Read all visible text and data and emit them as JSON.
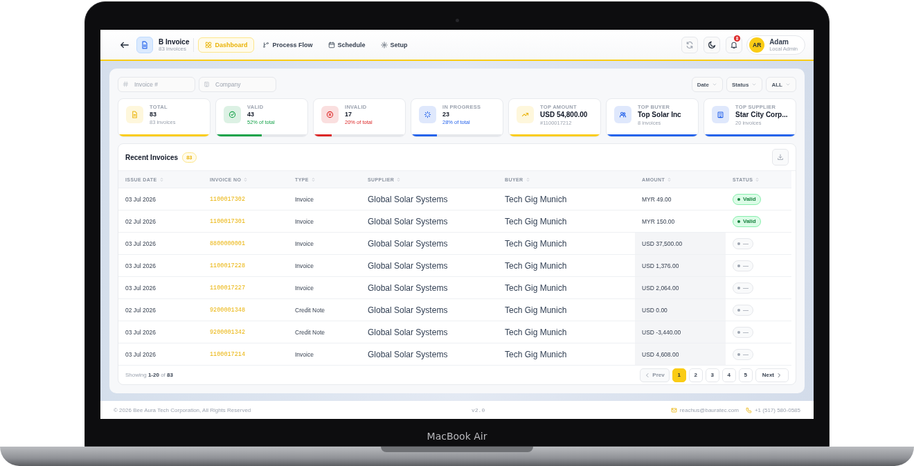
{
  "device": {
    "label": "MacBook Air"
  },
  "header": {
    "app_name": "B Invoice",
    "app_sub": "83 invoices",
    "tabs": [
      {
        "label": "Dashboard",
        "selected": true
      },
      {
        "label": "Process Flow",
        "selected": false
      },
      {
        "label": "Schedule",
        "selected": false
      },
      {
        "label": "Setup",
        "selected": false
      }
    ],
    "notification_count": "8",
    "user": {
      "initials": "AR",
      "name": "Adam",
      "role": "Local Admin"
    }
  },
  "filters": {
    "invoice_placeholder": "Invoice #",
    "company_placeholder": "Company",
    "dropdowns": [
      "Date",
      "Status",
      "ALL"
    ]
  },
  "stats": [
    {
      "kind": "count",
      "label": "TOTAL",
      "value": "83",
      "sub": "83 invoices",
      "color": "#facc15",
      "level": 1
    },
    {
      "kind": "share",
      "label": "VALID",
      "value": "43",
      "sub": "52% of total",
      "color": "#16a34a",
      "level": 0.5
    },
    {
      "kind": "share",
      "label": "INVALID",
      "value": "17",
      "sub": "20% of total",
      "color": "#dc2626",
      "level": 0.2
    },
    {
      "kind": "share",
      "label": "IN PROGRESS",
      "value": "23",
      "sub": "28% of total",
      "color": "#2563eb",
      "level": 0.28
    },
    {
      "kind": "count",
      "label": "TOP AMOUNT",
      "value": "USD 54,800.00",
      "sub": "#1100017212",
      "color": "#facc15",
      "level": 1
    },
    {
      "kind": "count",
      "label": "TOP BUYER",
      "value": "Top Solar Inc",
      "sub": "8 invoices",
      "color": "#2563eb",
      "level": 1
    },
    {
      "kind": "count",
      "label": "TOP SUPPLIER",
      "value": "Star City Corp...",
      "sub": "20 invoices",
      "color": "#2563eb",
      "level": 1
    }
  ],
  "table": {
    "title": "Recent Invoices",
    "count": "83",
    "columns": [
      "ISSUE DATE",
      "INVOICE NO",
      "TYPE",
      "SUPPLIER",
      "BUYER",
      "AMOUNT",
      "STATUS"
    ],
    "rows": [
      {
        "issue_date": "03 Jul 2026",
        "invoice_no": "1100017302",
        "type": "Invoice",
        "supplier": "Global Solar Systems",
        "buyer": "Tech Gig Munich",
        "amount": "MYR 49.00",
        "status": {
          "kind": "valid",
          "label": "Valid"
        }
      },
      {
        "issue_date": "02 Jul 2026",
        "invoice_no": "1100017301",
        "type": "Invoice",
        "supplier": "Global Solar Systems",
        "buyer": "Tech Gig Munich",
        "amount": "MYR 150.00",
        "status": {
          "kind": "valid",
          "label": "Valid"
        }
      },
      {
        "issue_date": "03 Jul 2026",
        "invoice_no": "8800000001",
        "type": "Invoice",
        "supplier": "Global Solar Systems",
        "buyer": "Tech Gig Munich",
        "amount": "USD 37,500.00",
        "status": {
          "kind": "none",
          "label": "—"
        }
      },
      {
        "issue_date": "03 Jul 2026",
        "invoice_no": "1100017228",
        "type": "Invoice",
        "supplier": "Global Solar Systems",
        "buyer": "Tech Gig Munich",
        "amount": "USD 1,376.00",
        "status": {
          "kind": "none",
          "label": "—"
        }
      },
      {
        "issue_date": "03 Jul 2026",
        "invoice_no": "1100017227",
        "type": "Invoice",
        "supplier": "Global Solar Systems",
        "buyer": "Tech Gig Munich",
        "amount": "USD 2,064.00",
        "status": {
          "kind": "none",
          "label": "—"
        }
      },
      {
        "issue_date": "02 Jul 2026",
        "invoice_no": "9200001348",
        "type": "Credit Note",
        "supplier": "Global Solar Systems",
        "buyer": "Tech Gig Munich",
        "amount": "USD 0.00",
        "status": {
          "kind": "none",
          "label": "—"
        }
      },
      {
        "issue_date": "03 Jul 2026",
        "invoice_no": "9200001342",
        "type": "Credit Note",
        "supplier": "Global Solar Systems",
        "buyer": "Tech Gig Munich",
        "amount": "USD -3,440.00",
        "status": {
          "kind": "none",
          "label": "—"
        }
      },
      {
        "issue_date": "03 Jul 2026",
        "invoice_no": "1100017214",
        "type": "Invoice",
        "supplier": "Global Solar Systems",
        "buyer": "Tech Gig Munich",
        "amount": "USD 4,608.00",
        "status": {
          "kind": "none",
          "label": "—"
        }
      }
    ],
    "showing": "Showing **1-20** of **83**",
    "pagination": {
      "prev": {
        "label": "Prev",
        "disabled": true
      },
      "pages": [
        {
          "label": "1",
          "selected": true
        },
        {
          "label": "2",
          "selected": false
        },
        {
          "label": "3",
          "selected": false
        },
        {
          "label": "4",
          "selected": false
        },
        {
          "label": "5",
          "selected": false
        }
      ],
      "next": {
        "label": "Next",
        "disabled": false
      }
    }
  },
  "footer": {
    "copyright": "© 2026 Bee Aura Tech Corporation, All Rights Reserved",
    "version": "v2.0",
    "email": "reachus@bauratec.com",
    "phone": "+1 (517) 580-0585"
  }
}
